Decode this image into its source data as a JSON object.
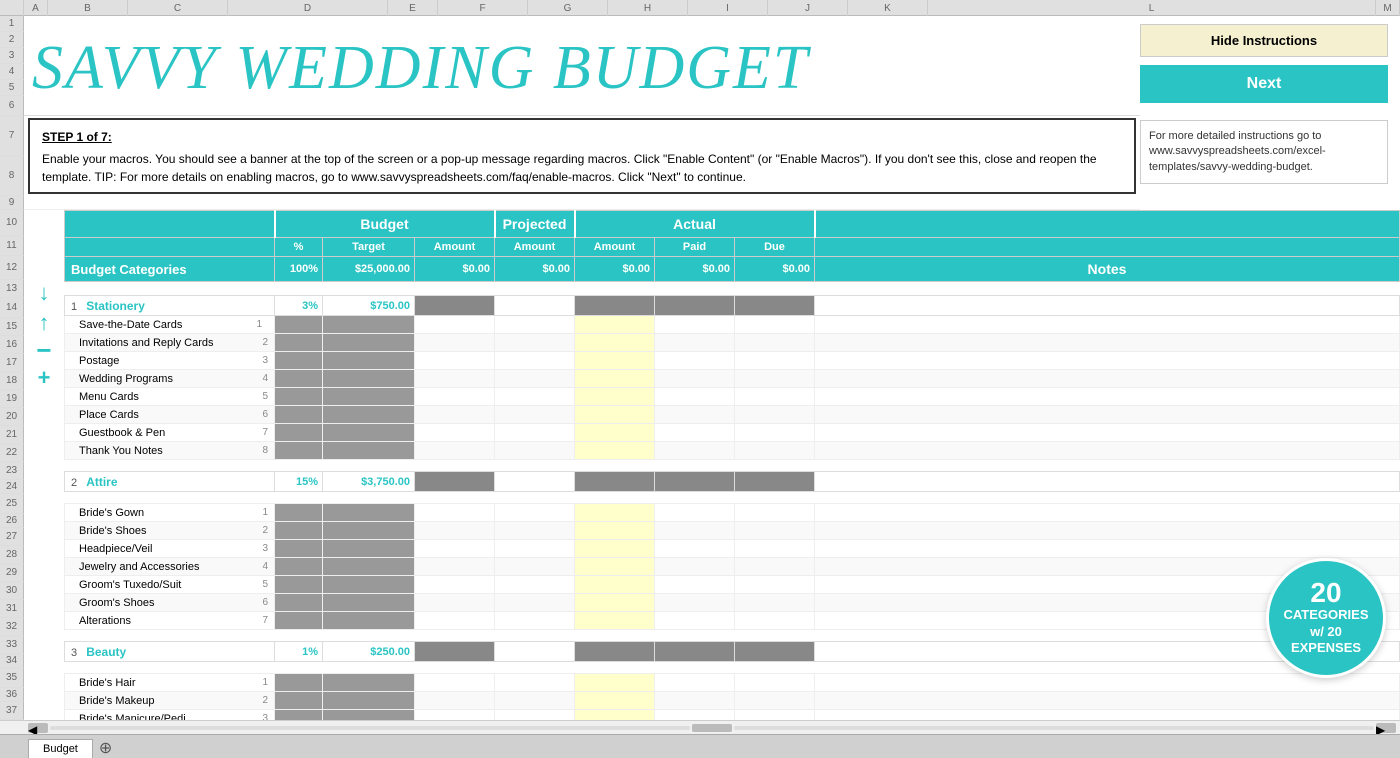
{
  "title": "SAVVY WEDDING BUDGET",
  "toolbar": {
    "hide_instructions": "Hide Instructions",
    "next_label": "Next"
  },
  "instructions": {
    "step": "STEP 1 of 7:",
    "body": "Enable your macros.  You should see a banner at the top of the screen or a pop-up message regarding macros.  Click \"Enable Content\" (or \"Enable Macros\").  If you don't see this, close and reopen the template.  TIP:  For more details on enabling macros, go to www.savvyspreadsheets.com/faq/enable-macros.  Click \"Next\" to continue.",
    "side_note": "For more detailed instructions go to www.savvyspreadsheets.com/excel-templates/savvy-wedding-budget."
  },
  "table": {
    "header": {
      "budget_label": "Budget",
      "projected_label": "Projected",
      "actual_label": "Actual",
      "notes_label": "Notes",
      "pct_label": "%",
      "target_label": "Target",
      "amount_label": "Amount",
      "proj_amount_label": "Amount",
      "act_amount_label": "Amount",
      "paid_label": "Paid",
      "due_label": "Due",
      "cat_label": "Budget Categories",
      "pct_total": "100%",
      "target_total": "$25,000.00",
      "amount_total": "$0.00",
      "proj_total": "$0.00",
      "act_total": "$0.00",
      "paid_total": "$0.00",
      "due_total": "$0.00"
    },
    "categories": [
      {
        "num": 1,
        "name": "Stationery",
        "pct": "3%",
        "target": "$750.00",
        "items": [
          "Save-the-Date Cards",
          "Invitations and Reply Cards",
          "Postage",
          "Wedding Programs",
          "Menu Cards",
          "Place Cards",
          "Guestbook & Pen",
          "Thank You Notes"
        ]
      },
      {
        "num": 2,
        "name": "Attire",
        "pct": "15%",
        "target": "$3,750.00",
        "items": [
          "Bride's Gown",
          "Bride's Shoes",
          "Headpiece/Veil",
          "Jewelry and Accessories",
          "Groom's Tuxedo/Suit",
          "Groom's Shoes",
          "Alterations"
        ]
      },
      {
        "num": 3,
        "name": "Beauty",
        "pct": "1%",
        "target": "$250.00",
        "items": [
          "Bride's Hair",
          "Bride's Makeup",
          "Bride's Manicure/Pedi..."
        ]
      }
    ]
  },
  "badge": {
    "big_num": "20",
    "line2": "CATEGORIES",
    "line3": "w/ 20",
    "line4": "EXPENSES"
  },
  "controls": {
    "down_arrow": "↓",
    "up_arrow": "↑",
    "minus": "−",
    "plus": "+"
  },
  "tabs": [
    {
      "label": "Budget"
    }
  ]
}
